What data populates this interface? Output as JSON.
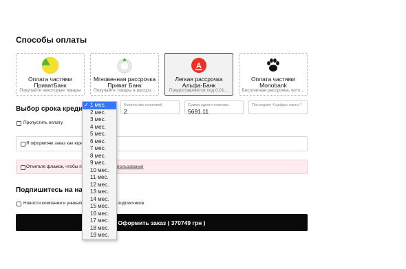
{
  "payment": {
    "title": "Способы оплаты",
    "cards": [
      {
        "line1": "Оплата частями",
        "line2": "ПриватБанк",
        "desc": "Покупайте некоторые товары",
        "icon": "privatbank-pie-icon"
      },
      {
        "line1": "Мгновенная рассрочка",
        "line2": "Приват Банк",
        "desc": "Покупайте товары в рассро…",
        "icon": "privatbank-instant-icon"
      },
      {
        "line1": "Легкая рассрочка",
        "line2": "Альфа-Банк",
        "desc": "Предоставляется под 0,01…",
        "icon": "alfabank-icon"
      },
      {
        "line1": "Оплата частями",
        "line2": "Monobank",
        "desc": "Бесплатная рассрочка, кото…",
        "icon": "monobank-paw-icon"
      }
    ]
  },
  "credit": {
    "title": "Выбор срока кредита",
    "payments_count_label": "Количество платежей",
    "payments_count_value": "2",
    "payment_amount_label": "Сумма одного платежа",
    "payment_amount_value": "5691.11",
    "card_digits_label": "Последние 4 цифры карты",
    "required_mark": "*"
  },
  "skip_payment": "Пропустить оплату",
  "legal_entity": "Я оформляю заказ как юрид",
  "terms_prefix": "Отметьте флажок, чтобы при",
  "terms_link": "пользования",
  "subscribe_title": "Подпишитесь на нашу",
  "subscribe_news": "Новости компании и уникаль",
  "subscribe_suffix": "подписчиков",
  "submit_label": "Оформить заказ ( 370749 грн )",
  "dropdown": {
    "selected_index": 0,
    "options": [
      "1 мес.",
      "2 мес.",
      "3 мес.",
      "4 мес.",
      "5 мес.",
      "6 мес.",
      "7 мес.",
      "8 мес.",
      "9 мес.",
      "10 мес.",
      "11 мес.",
      "12 мес.",
      "13 мес.",
      "14 мес.",
      "15 мес.",
      "16 мес.",
      "17 мес.",
      "18 мес.",
      "19 мес."
    ]
  },
  "colors": {
    "privat_yellow": "#f7df32",
    "privat_green": "#5cb531",
    "alfa_red": "#ef3124",
    "terms_bg": "#fdebed",
    "select_blue": "#3478f6"
  }
}
